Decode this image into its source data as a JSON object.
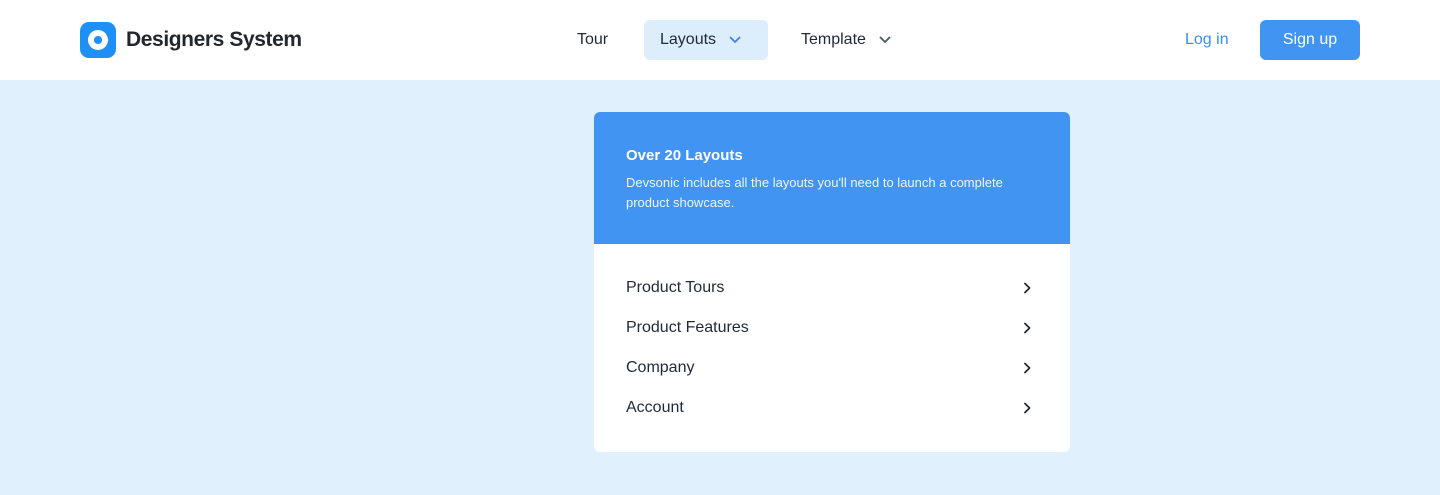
{
  "brand": {
    "name": "Designers System",
    "logo_icon": "swirl-logo-icon",
    "accent_color": "#1e90f5"
  },
  "nav": {
    "tour": "Tour",
    "layouts": "Layouts",
    "template": "Template",
    "layouts_active_bg": "#dcedfc"
  },
  "auth": {
    "login": "Log in",
    "signup": "Sign up",
    "signup_color": "#4094f2"
  },
  "dropdown": {
    "title": "Over 20 Layouts",
    "description": "Devsonic includes all the layouts you'll need to launch a complete product showcase.",
    "header_color": "#4294f3",
    "items": [
      {
        "label": "Product Tours",
        "icon": "chevron-right-icon"
      },
      {
        "label": "Product Features",
        "icon": "chevron-right-icon"
      },
      {
        "label": "Company",
        "icon": "chevron-right-icon"
      },
      {
        "label": "Account",
        "icon": "chevron-right-icon"
      }
    ]
  },
  "page": {
    "background": "#e0f0fd"
  }
}
